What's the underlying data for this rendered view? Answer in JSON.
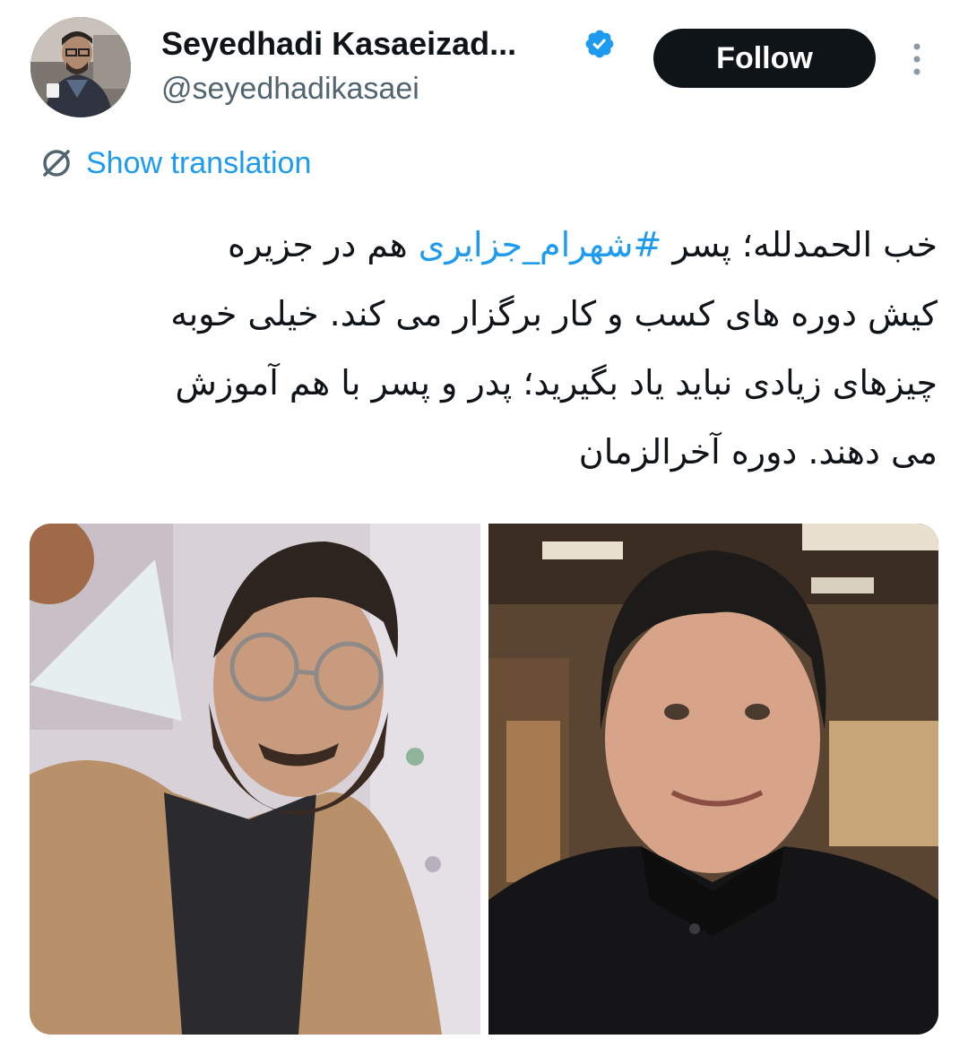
{
  "author": {
    "display_name": "Seyedhadi Kasaeizad...",
    "handle": "@seyedhadikasaei",
    "verified": true,
    "verified_color": "#1d9bf0"
  },
  "follow_button": {
    "label": "Follow"
  },
  "more_icon": "more-vertical-icon",
  "translation": {
    "label": "Show translation",
    "icon": "translate-icon"
  },
  "tweet": {
    "line1_before": "خب الحمدلله؛ پسر ",
    "hashtag": "#شهرام_جزایری",
    "line1_after": " هم در جزیره",
    "line2": "کیش دوره های کسب و کار برگزار می کند. خیلی خوبه",
    "line3": "چیزهای زیادی نباید یاد بگیرید؛ پدر و پسر با هم آموزش",
    "line4": "می دهند. دوره آخرالزمان"
  },
  "media": [
    {
      "name": "photo-young-man-glasses"
    },
    {
      "name": "photo-man-black-jacket"
    }
  ],
  "colors": {
    "text": "#0f1419",
    "secondary": "#536471",
    "accent": "#1d9bf0",
    "button_bg": "#0f1419"
  }
}
